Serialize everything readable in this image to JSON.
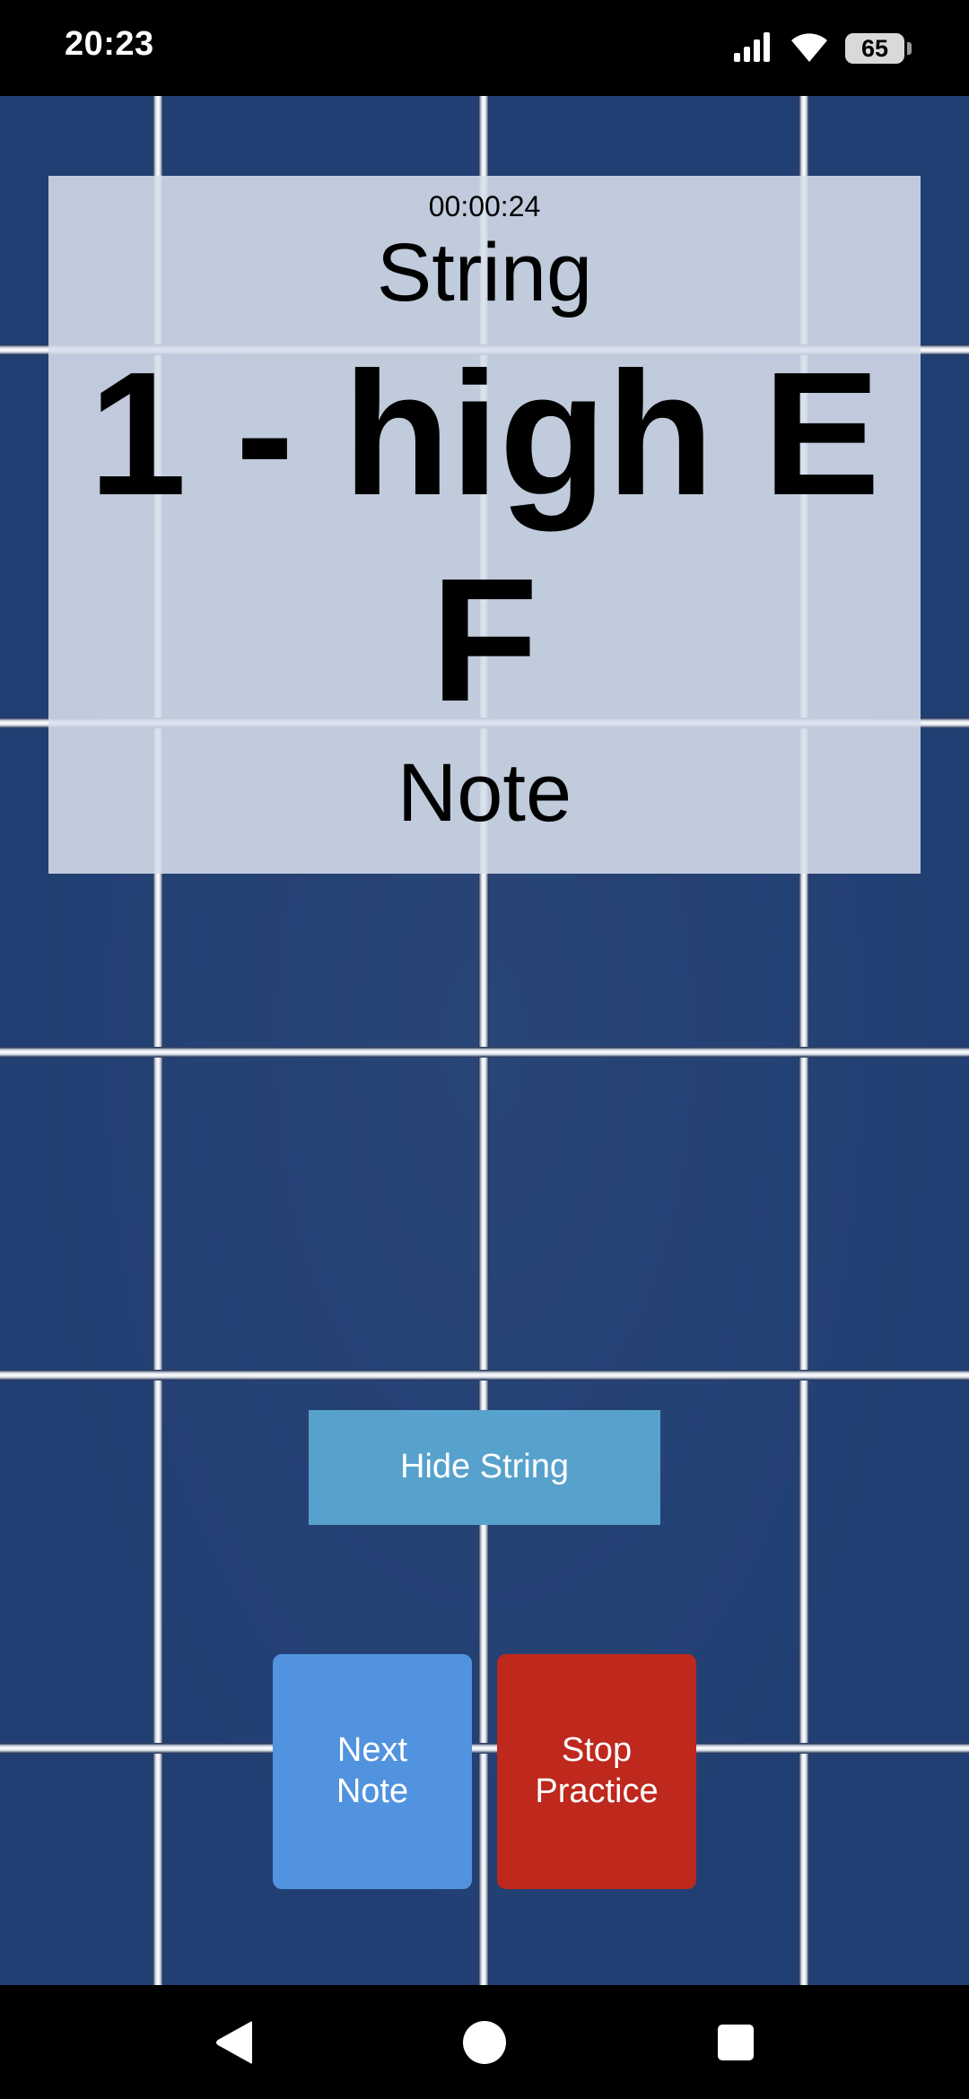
{
  "status_bar": {
    "time": "20:23",
    "battery_level": "65",
    "icons": [
      "signal-icon",
      "wifi-icon",
      "battery-icon"
    ]
  },
  "panel": {
    "timer": "00:00:24",
    "string_label": "String",
    "string_value": "1 - high E",
    "note_value": "F",
    "note_label": "Note"
  },
  "buttons": {
    "hide_string": "Hide String",
    "next_note": "Next\nNote",
    "stop_practice": "Stop\nPractice"
  },
  "nav_bar": {
    "icons": [
      "back-icon",
      "home-icon",
      "recents-icon"
    ]
  },
  "colors": {
    "tile": "#223f73",
    "hide_button": "#57a2cc",
    "next_button": "#5193de",
    "stop_button": "#be281d"
  }
}
